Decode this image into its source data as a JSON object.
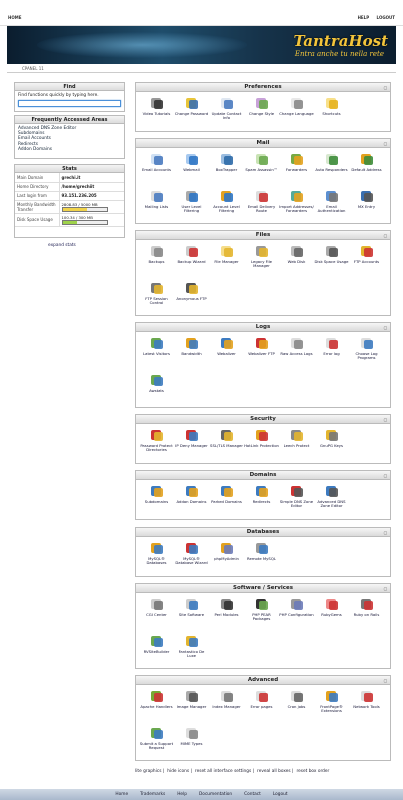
{
  "topnav": {
    "home": "HOME",
    "help": "HELP",
    "logout": "LOGOUT"
  },
  "banner": {
    "brand": "TantraHost",
    "tagline": "Entra anche tu nella rete"
  },
  "breadcrumb": "CPANEL 11",
  "sidebar": {
    "find": {
      "title": "Find",
      "description": "Find functions quickly by typing here.",
      "value": ""
    },
    "frequent": {
      "title": "Frequently Accessed Areas",
      "items": [
        "Advanced DNS Zone Editor",
        "Subdomains",
        "Email Accounts",
        "Redirects",
        "Addon Domains"
      ]
    },
    "stats": {
      "title": "Stats",
      "rows": [
        {
          "label": "Main Domain",
          "value": "grechi.it"
        },
        {
          "label": "Home Directory",
          "value": "/home/grechiit"
        },
        {
          "label": "Last login from",
          "value": "93.151.236.205"
        },
        {
          "label": "Monthly Bandwidth Transfer",
          "value": "2808.83 / 5000 MB",
          "fraction": 0.56,
          "color": "#f0d34b"
        },
        {
          "label": "Disk Space Usage",
          "value": "100.34 / 300 MB",
          "fraction": 0.33,
          "color": "#9ed24a"
        }
      ],
      "expand": "expand stats"
    }
  },
  "panels": [
    {
      "title": "Preferences",
      "items": [
        {
          "label": "Video Tutorials",
          "icon": "video-icon",
          "c1": "#333",
          "c2": "#999"
        },
        {
          "label": "Change Password",
          "icon": "password-icon",
          "c1": "#3a6fb0",
          "c2": "#e8c53a"
        },
        {
          "label": "Update Contact Info",
          "icon": "contact-icon",
          "c1": "#4a7bc0",
          "c2": "#dfe7f1"
        },
        {
          "label": "Change Style",
          "icon": "style-icon",
          "c1": "#6aa84f",
          "c2": "#c8a2d8"
        },
        {
          "label": "Change Language",
          "icon": "language-icon",
          "c1": "#888",
          "c2": "#e8e8e8"
        },
        {
          "label": "Shortcuts",
          "icon": "shortcut-icon",
          "c1": "#e6b21e",
          "c2": "#f8e08a"
        }
      ]
    },
    {
      "title": "Mail",
      "items": [
        {
          "label": "Email Accounts",
          "icon": "email-icon",
          "c1": "#4a7bc0",
          "c2": "#cfe0f3"
        },
        {
          "label": "Webmail",
          "icon": "webmail-icon",
          "c1": "#2f76c4",
          "c2": "#a7c9ef"
        },
        {
          "label": "BoxTrapper",
          "icon": "boxtrapper-icon",
          "c1": "#2d6aa8",
          "c2": "#9bbde0"
        },
        {
          "label": "Spam Assassin™",
          "icon": "spam-icon",
          "c1": "#6aa84f",
          "c2": "#c9e3b5"
        },
        {
          "label": "Forwarders",
          "icon": "forwarder-icon",
          "c1": "#e3a21f",
          "c2": "#7a4"
        },
        {
          "label": "Auto Responders",
          "icon": "autoresponder-icon",
          "c1": "#3d8c3a",
          "c2": "#d8e8d0"
        },
        {
          "label": "Default Address",
          "icon": "default-address-icon",
          "c1": "#3d8c3a",
          "c2": "#e3a21f"
        },
        {
          "label": "Mailing Lists",
          "icon": "mailing-list-icon",
          "c1": "#4a7bc0",
          "c2": "#ddd"
        },
        {
          "label": "User Level Filtering",
          "icon": "user-filter-icon",
          "c1": "#2f76c4",
          "c2": "#aaa"
        },
        {
          "label": "Account Level Filtering",
          "icon": "account-filter-icon",
          "c1": "#2f76c4",
          "c2": "#e3a21f"
        },
        {
          "label": "Email Delivery Route",
          "icon": "delivery-route-icon",
          "c1": "#c33",
          "c2": "#ddd"
        },
        {
          "label": "Import Addresses/ Forwarders",
          "icon": "import-icon",
          "c1": "#e3a21f",
          "c2": "#5a9"
        },
        {
          "label": "Email Authentication",
          "icon": "authentication-icon",
          "c1": "#777",
          "c2": "#5c8fd0"
        },
        {
          "label": "MX Entry",
          "icon": "mx-entry-icon",
          "c1": "#555",
          "c2": "#3a6fb0"
        }
      ]
    },
    {
      "title": "Files",
      "items": [
        {
          "label": "Backups",
          "icon": "backup-icon",
          "c1": "#888",
          "c2": "#ccc"
        },
        {
          "label": "Backup Wizard",
          "icon": "backup-wizard-icon",
          "c1": "#c33",
          "c2": "#ccc"
        },
        {
          "label": "File Manager",
          "icon": "file-manager-icon",
          "c1": "#e3b52f",
          "c2": "#f5dd8a"
        },
        {
          "label": "Legacy File Manager",
          "icon": "legacy-file-icon",
          "c1": "#e3b52f",
          "c2": "#999"
        },
        {
          "label": "Web Disk",
          "icon": "web-disk-icon",
          "c1": "#666",
          "c2": "#bbb"
        },
        {
          "label": "Disk Space Usage",
          "icon": "disk-usage-icon",
          "c1": "#555",
          "c2": "#aaa"
        },
        {
          "label": "FTP Accounts",
          "icon": "ftp-accounts-icon",
          "c1": "#c33",
          "c2": "#e3b52f"
        },
        {
          "label": "FTP Session Control",
          "icon": "ftp-session-icon",
          "c1": "#e3b52f",
          "c2": "#777"
        },
        {
          "label": "Anonymous FTP",
          "icon": "anonymous-ftp-icon",
          "c1": "#e3b52f",
          "c2": "#555"
        }
      ]
    },
    {
      "title": "Logs",
      "items": [
        {
          "label": "Latest Visitors",
          "icon": "visitors-icon",
          "c1": "#3d7bc0",
          "c2": "#6aa84f"
        },
        {
          "label": "Bandwidth",
          "icon": "bandwidth-icon",
          "c1": "#3d7bc0",
          "c2": "#e3a21f"
        },
        {
          "label": "Webalizer",
          "icon": "webalizer-icon",
          "c1": "#e3a21f",
          "c2": "#3d7bc0"
        },
        {
          "label": "Webalizer FTP",
          "icon": "webalizer-ftp-icon",
          "c1": "#e3a21f",
          "c2": "#c33"
        },
        {
          "label": "Raw Access Logs",
          "icon": "raw-logs-icon",
          "c1": "#888",
          "c2": "#ddd"
        },
        {
          "label": "Error log",
          "icon": "error-log-icon",
          "c1": "#c33",
          "c2": "#ddd"
        },
        {
          "label": "Choose Log Programs",
          "icon": "log-programs-icon",
          "c1": "#3d7bc0",
          "c2": "#ddd"
        },
        {
          "label": "Awstats",
          "icon": "awstats-icon",
          "c1": "#3d7bc0",
          "c2": "#6aa84f"
        }
      ]
    },
    {
      "title": "Security",
      "items": [
        {
          "label": "Password Protect Directories",
          "icon": "protect-dir-icon",
          "c1": "#e3b52f",
          "c2": "#c33"
        },
        {
          "label": "IP Deny Manager",
          "icon": "ip-deny-icon",
          "c1": "#3d7bc0",
          "c2": "#c33"
        },
        {
          "label": "SSL/TLS Manager",
          "icon": "ssl-icon",
          "c1": "#e3b52f",
          "c2": "#666"
        },
        {
          "label": "HotLink Protection",
          "icon": "hotlink-icon",
          "c1": "#c33",
          "c2": "#e3a21f"
        },
        {
          "label": "Leech Protect",
          "icon": "leech-icon",
          "c1": "#e3b52f",
          "c2": "#888"
        },
        {
          "label": "GnuPG Keys",
          "icon": "gnupg-icon",
          "c1": "#777",
          "c2": "#e3b52f"
        }
      ]
    },
    {
      "title": "Domains",
      "items": [
        {
          "label": "Subdomains",
          "icon": "subdomain-icon",
          "c1": "#e3a21f",
          "c2": "#3d7bc0"
        },
        {
          "label": "Addon Domains",
          "icon": "addon-domain-icon",
          "c1": "#e3a21f",
          "c2": "#3d7bc0"
        },
        {
          "label": "Parked Domains",
          "icon": "parked-domain-icon",
          "c1": "#e3a21f",
          "c2": "#3d7bc0"
        },
        {
          "label": "Redirects",
          "icon": "redirect-icon",
          "c1": "#e3a21f",
          "c2": "#3d7bc0"
        },
        {
          "label": "Simple DNS Zone Editor",
          "icon": "simple-dns-icon",
          "c1": "#555",
          "c2": "#c33"
        },
        {
          "label": "Advanced DNS Zone Editor",
          "icon": "advanced-dns-icon",
          "c1": "#555",
          "c2": "#3d7bc0"
        }
      ]
    },
    {
      "title": "Databases",
      "items": [
        {
          "label": "MySQL® Databases",
          "icon": "mysql-icon",
          "c1": "#3d7bc0",
          "c2": "#e3a21f"
        },
        {
          "label": "MySQL® Database Wizard",
          "icon": "mysql-wizard-icon",
          "c1": "#3d7bc0",
          "c2": "#c33"
        },
        {
          "label": "phpMyAdmin",
          "icon": "phpmyadmin-icon",
          "c1": "#6b7bb8",
          "c2": "#e3a21f"
        },
        {
          "label": "Remote MySQL",
          "icon": "remote-mysql-icon",
          "c1": "#3d7bc0",
          "c2": "#999"
        }
      ]
    },
    {
      "title": "Software / Services",
      "items": [
        {
          "label": "CGI Center",
          "icon": "cgi-icon",
          "c1": "#777",
          "c2": "#ccc"
        },
        {
          "label": "Site Software",
          "icon": "site-software-icon",
          "c1": "#3d7bc0",
          "c2": "#ccc"
        },
        {
          "label": "Perl Modules",
          "icon": "perl-icon",
          "c1": "#333",
          "c2": "#888"
        },
        {
          "label": "PHP PEAR Packages",
          "icon": "pear-icon",
          "c1": "#6aa84f",
          "c2": "#333"
        },
        {
          "label": "PHP Configuration",
          "icon": "php-config-icon",
          "c1": "#6b7bb8",
          "c2": "#999"
        },
        {
          "label": "RubyGems",
          "icon": "rubygems-icon",
          "c1": "#c33",
          "c2": "#e88"
        },
        {
          "label": "Ruby on Rails",
          "icon": "rails-icon",
          "c1": "#c33",
          "c2": "#777"
        },
        {
          "label": "RVSiteBuilder",
          "icon": "rvsitebuilder-icon",
          "c1": "#3d7bc0",
          "c2": "#6aa84f"
        },
        {
          "label": "Fantastico De Luxe",
          "icon": "fantastico-icon",
          "c1": "#3d7bc0",
          "c2": "#e3b52f"
        }
      ]
    },
    {
      "title": "Advanced",
      "items": [
        {
          "label": "Apache Handlers",
          "icon": "apache-icon",
          "c1": "#c33",
          "c2": "#7a3"
        },
        {
          "label": "Image Manager",
          "icon": "image-manager-icon",
          "c1": "#555",
          "c2": "#aaa"
        },
        {
          "label": "Index Manager",
          "icon": "index-manager-icon",
          "c1": "#777",
          "c2": "#ddd"
        },
        {
          "label": "Error pages",
          "icon": "error-pages-icon",
          "c1": "#c33",
          "c2": "#ddd"
        },
        {
          "label": "Cron jobs",
          "icon": "cron-icon",
          "c1": "#666",
          "c2": "#ddd"
        },
        {
          "label": "FrontPage® Extensions",
          "icon": "frontpage-icon",
          "c1": "#3d7bc0",
          "c2": "#e3a21f"
        },
        {
          "label": "Network Tools",
          "icon": "network-tools-icon",
          "c1": "#c33",
          "c2": "#ddd"
        },
        {
          "label": "Submit a Support Request",
          "icon": "support-icon",
          "c1": "#3d7bc0",
          "c2": "#6aa84f"
        },
        {
          "label": "MIME Types",
          "icon": "mime-icon",
          "c1": "#888",
          "c2": "#ddd"
        }
      ]
    }
  ],
  "footer_links": [
    "lite graphics",
    "hide icons",
    "reset all interface settings",
    "reveal all boxes",
    "reset box order"
  ],
  "bottom_links": [
    "Home",
    "Trademarks",
    "Help",
    "Documentation",
    "Contact",
    "Logout"
  ]
}
